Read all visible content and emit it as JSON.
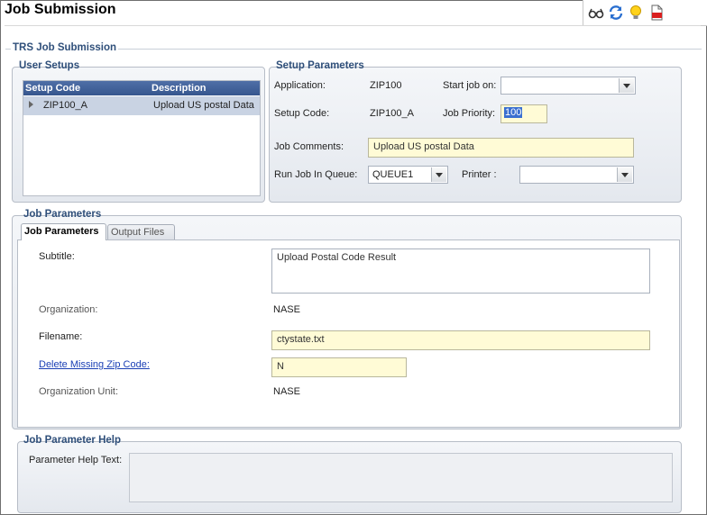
{
  "page": {
    "title": "Job Submission"
  },
  "toolbar": {
    "icons": [
      "glasses-icon",
      "refresh-icon",
      "lightbulb-icon",
      "pdf-report-icon"
    ]
  },
  "trs": {
    "legend": "TRS Job Submission"
  },
  "user_setups": {
    "legend": "User Setups",
    "columns": [
      "Setup Code",
      "Description"
    ],
    "rows": [
      {
        "code": "ZIP100_A",
        "description": "Upload US postal Data"
      }
    ]
  },
  "setup_params": {
    "legend": "Setup Parameters",
    "application_label": "Application:",
    "application_value": "ZIP100",
    "setup_code_label": "Setup Code:",
    "setup_code_value": "ZIP100_A",
    "start_job_label": "Start job on:",
    "start_job_value": "",
    "priority_label": "Job Priority:",
    "priority_value": "100",
    "comments_label": "Job Comments:",
    "comments_value": "Upload US postal Data",
    "queue_label": "Run Job In Queue:",
    "queue_value": "QUEUE1",
    "printer_label": "Printer :",
    "printer_value": ""
  },
  "job_params": {
    "legend": "Job Parameters",
    "tabs": [
      "Job Parameters",
      "Output Files"
    ],
    "subtitle_label": "Subtitle:",
    "subtitle_value": "Upload Postal Code Result",
    "org_label": "Organization:",
    "org_value": "NASE",
    "filename_label": "Filename:",
    "filename_value": "ctystate.txt",
    "delete_label": "Delete Missing Zip Code:",
    "delete_value": "N",
    "org_unit_label": "Organization Unit:",
    "org_unit_value": "NASE"
  },
  "help": {
    "legend": "Job Parameter Help",
    "text_label": "Parameter Help Text:",
    "text_value": ""
  }
}
